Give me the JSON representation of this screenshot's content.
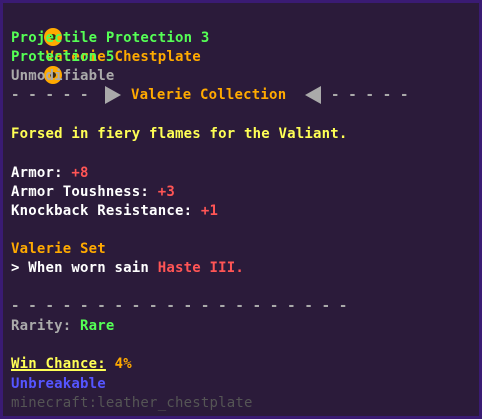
{
  "item": {
    "name": "Valerie Chestplate",
    "enchantments": [
      "Projectile Protection 3",
      "Protection 5"
    ],
    "unmodifiable": "Unmodifiable",
    "collection": "Valerie Collection",
    "lore": "Forsed in fiery flames for the Valiant.",
    "stats": [
      {
        "label": "Armor:",
        "value": "+8"
      },
      {
        "label": "Armor Toushness:",
        "value": "+3"
      },
      {
        "label": "Knockback Resistance:",
        "value": "+1"
      }
    ],
    "set": {
      "title": "Valerie Set",
      "bonus_prefix": "> When worn sain",
      "bonus_effect": "Haste III."
    },
    "separator": "- - - - - - - - - - - - - - - - - - - -",
    "divider_left": "- - - - -",
    "divider_right": "- - - - -",
    "rarity": {
      "label": "Rarity:",
      "value": "Rare"
    },
    "win_chance": {
      "label": "Win Chance:",
      "value": "4%"
    },
    "unbreakable": "Unbreakable",
    "item_id": "minecraft:leather_chestplate"
  },
  "colors": {
    "background": "#2b1b3a",
    "border": "#3a1b73",
    "gold": "#ffaa00",
    "green": "#55ff55",
    "gray": "#aaaaaa",
    "red": "#ff5555",
    "yellow": "#ffff55",
    "blue": "#5555ff",
    "dark_gray": "#555555"
  },
  "icons": {
    "title_left": "sun-emblem-icon",
    "title_right": "sun-emblem-icon",
    "divider_left": "triangle-right-icon",
    "divider_right": "triangle-left-icon"
  }
}
